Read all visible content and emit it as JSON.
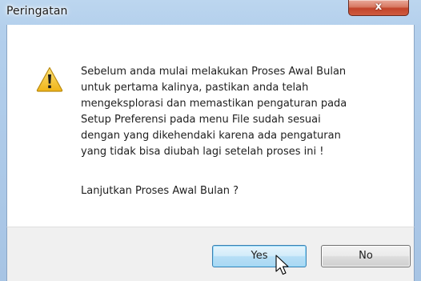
{
  "window": {
    "title": "Peringatan",
    "close_glyph": "x"
  },
  "message": {
    "lines": [
      "Sebelum anda mulai melakukan Proses Awal Bulan",
      "untuk pertama kalinya, pastikan anda telah",
      "mengeksplorasi dan memastikan pengaturan pada",
      "Setup Preferensi pada menu File sudah sesuai",
      "dengan yang dikehendaki karena ada pengaturan",
      "yang tidak bisa diubah lagi setelah proses ini !"
    ],
    "question": "Lanjutkan Proses Awal Bulan ?"
  },
  "buttons": {
    "yes_label": "Yes",
    "no_label": "No"
  },
  "icons": {
    "warning": "warning-icon",
    "close": "close-icon",
    "cursor": "mouse-pointer-icon"
  },
  "colors": {
    "warning_fill": "#f6c531",
    "close_red": "#c2442a",
    "default_button_border": "#3c7fb1"
  }
}
